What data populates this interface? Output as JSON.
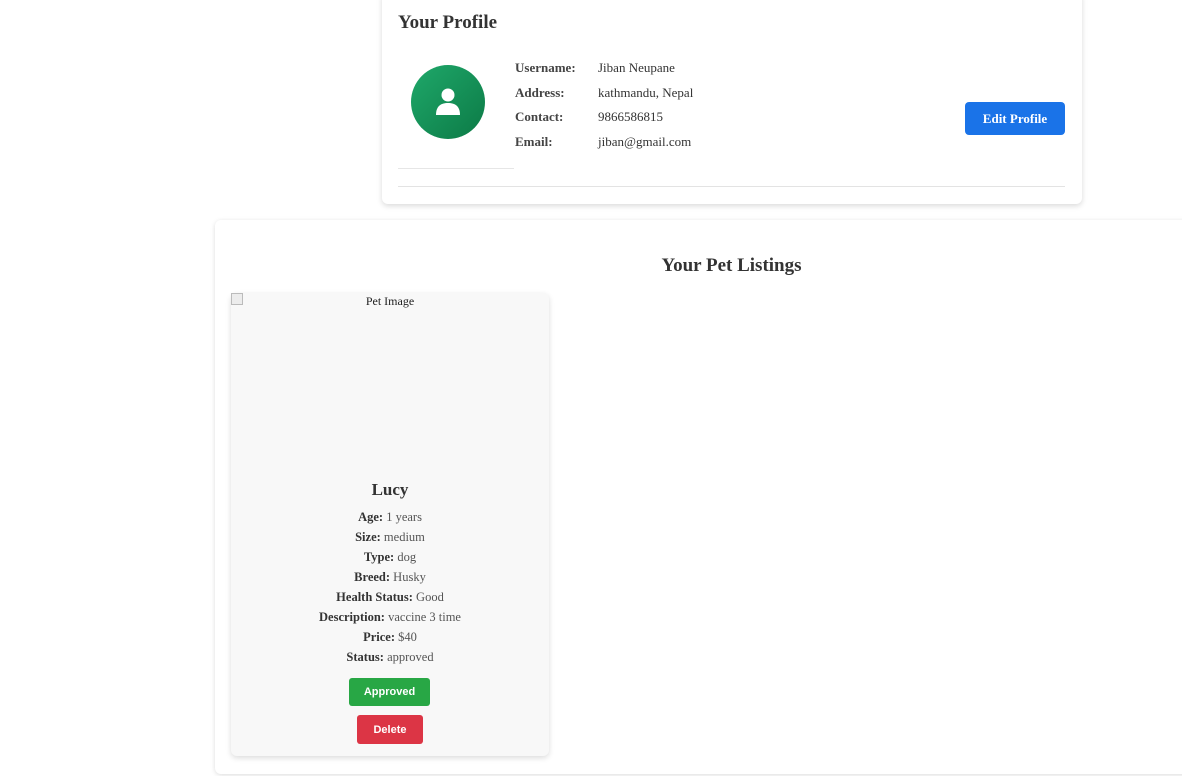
{
  "profile": {
    "title": "Your Profile",
    "avatar_icon": "user-icon",
    "fields": [
      {
        "label": "Username:",
        "value": "Jiban Neupane"
      },
      {
        "label": "Address:",
        "value": "kathmandu, Nepal"
      },
      {
        "label": "Contact:",
        "value": "9866586815"
      },
      {
        "label": "Email:",
        "value": "jiban@gmail.com"
      }
    ],
    "edit_button": "Edit Profile"
  },
  "listings": {
    "title": "Your Pet Listings",
    "pets": [
      {
        "image_alt": "Pet Image",
        "name": "Lucy",
        "attributes": [
          {
            "label": "Age:",
            "value": "1 years"
          },
          {
            "label": "Size:",
            "value": "medium"
          },
          {
            "label": "Type:",
            "value": "dog"
          },
          {
            "label": "Breed:",
            "value": "Husky"
          },
          {
            "label": "Health Status:",
            "value": "Good"
          },
          {
            "label": "Description:",
            "value": "vaccine 3 time"
          },
          {
            "label": "Price:",
            "value": "$40"
          },
          {
            "label": "Status:",
            "value": "approved"
          }
        ],
        "approved_button": "Approved",
        "delete_button": "Delete"
      }
    ]
  },
  "colors": {
    "primary": "#1a73e8",
    "success": "#28a745",
    "danger": "#dc3545",
    "avatar": "#13935a"
  }
}
